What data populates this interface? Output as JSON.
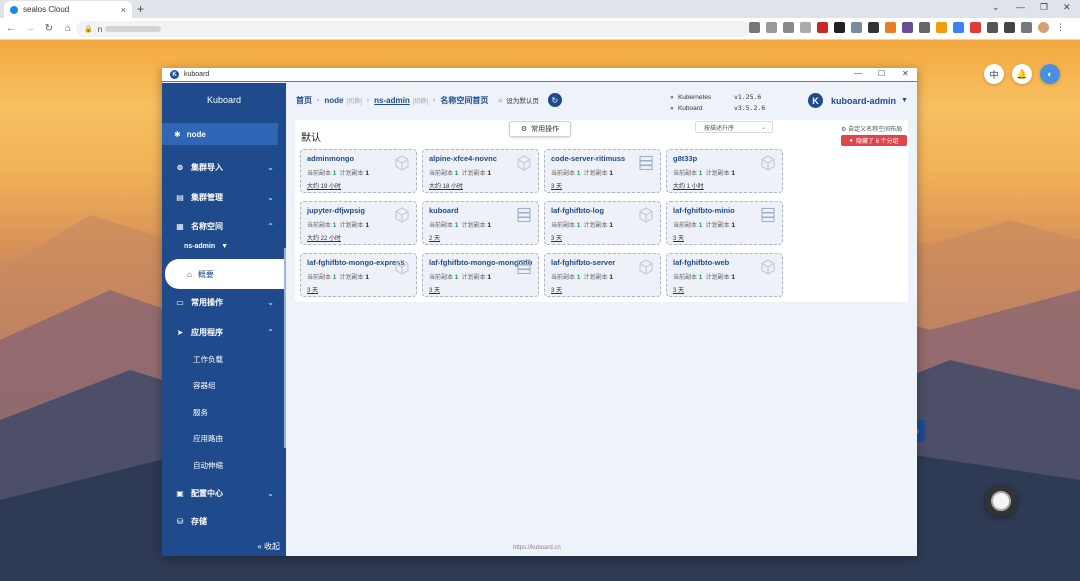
{
  "browser": {
    "tab_title": "sealos Cloud",
    "tab_close": "×",
    "new_tab": "+",
    "address_prefix": "n"
  },
  "desktop": {
    "lang_label": "中"
  },
  "window": {
    "title": "kuboard"
  },
  "sidebar": {
    "brand": "Kuboard",
    "node_label": "node",
    "cluster_import": "集群导入",
    "cluster_manage": "集群管理",
    "namespace": "名称空间",
    "namespace_current": "ns-admin",
    "overview": "概要",
    "common_ops": "常用操作",
    "applications": "应用程序",
    "sub_items": [
      "工作负载",
      "容器组",
      "服务",
      "应用路由",
      "自动伸缩"
    ],
    "config_center": "配置中心",
    "storage": "存储",
    "collapse": "收起"
  },
  "topbar": {
    "home": "首页",
    "node": "node",
    "tag1": "[切换]",
    "namespace": "ns-admin",
    "tag2": "[切换]",
    "page": "名称空间首页",
    "set_default": "设为默认页",
    "k8s_label": "Kubernetes",
    "k8s_version": "v1.25.6",
    "kuboard_label": "Kuboard",
    "kuboard_version": "v3.5.2.6",
    "user": "kuboard-admin"
  },
  "main": {
    "ops_button": "常用操作",
    "section_title": "默认",
    "sort_select": "按描述升序",
    "custom_layout": "自定义名称空间布局",
    "hidden_badge": "隐藏了 6 个分组",
    "current_label": "当前副本",
    "planned_label": "计划副本",
    "cards": [
      {
        "name": "adminmongo",
        "current": "1",
        "planned": "1",
        "age": "大约 19 小时",
        "icon": "cube"
      },
      {
        "name": "alpine-xfce4-novnc",
        "current": "1",
        "planned": "1",
        "age": "大约 18 小时",
        "icon": "cube"
      },
      {
        "name": "code-server-ritimuss",
        "current": "1",
        "planned": "1",
        "age": "3 天",
        "icon": "stack"
      },
      {
        "name": "g8t33p",
        "current": "1",
        "planned": "1",
        "age": "大约 1 小时",
        "icon": "cube"
      },
      {
        "name": "jupyter-dfjwpsig",
        "current": "1",
        "planned": "1",
        "age": "大约 22 小时",
        "icon": "cube"
      },
      {
        "name": "kuboard",
        "current": "1",
        "planned": "1",
        "age": "2 天",
        "icon": "stack"
      },
      {
        "name": "laf-fghifbto-log",
        "current": "1",
        "planned": "1",
        "age": "3 天",
        "icon": "cube"
      },
      {
        "name": "laf-fghifbto-minio",
        "current": "1",
        "planned": "1",
        "age": "3 天",
        "icon": "stack"
      },
      {
        "name": "laf-fghifbto-mongo-express",
        "current": "1",
        "planned": "1",
        "age": "3 天",
        "icon": "cube"
      },
      {
        "name": "laf-fghifbto-mongo-mongodb",
        "current": "1",
        "planned": "1",
        "age": "3 天",
        "icon": "stack"
      },
      {
        "name": "laf-fghifbto-server",
        "current": "1",
        "planned": "1",
        "age": "3 天",
        "icon": "cube"
      },
      {
        "name": "laf-fghifbto-web",
        "current": "1",
        "planned": "1",
        "age": "3 天",
        "icon": "cube"
      }
    ]
  },
  "footer": {
    "url": "https://kuboard.cn"
  }
}
